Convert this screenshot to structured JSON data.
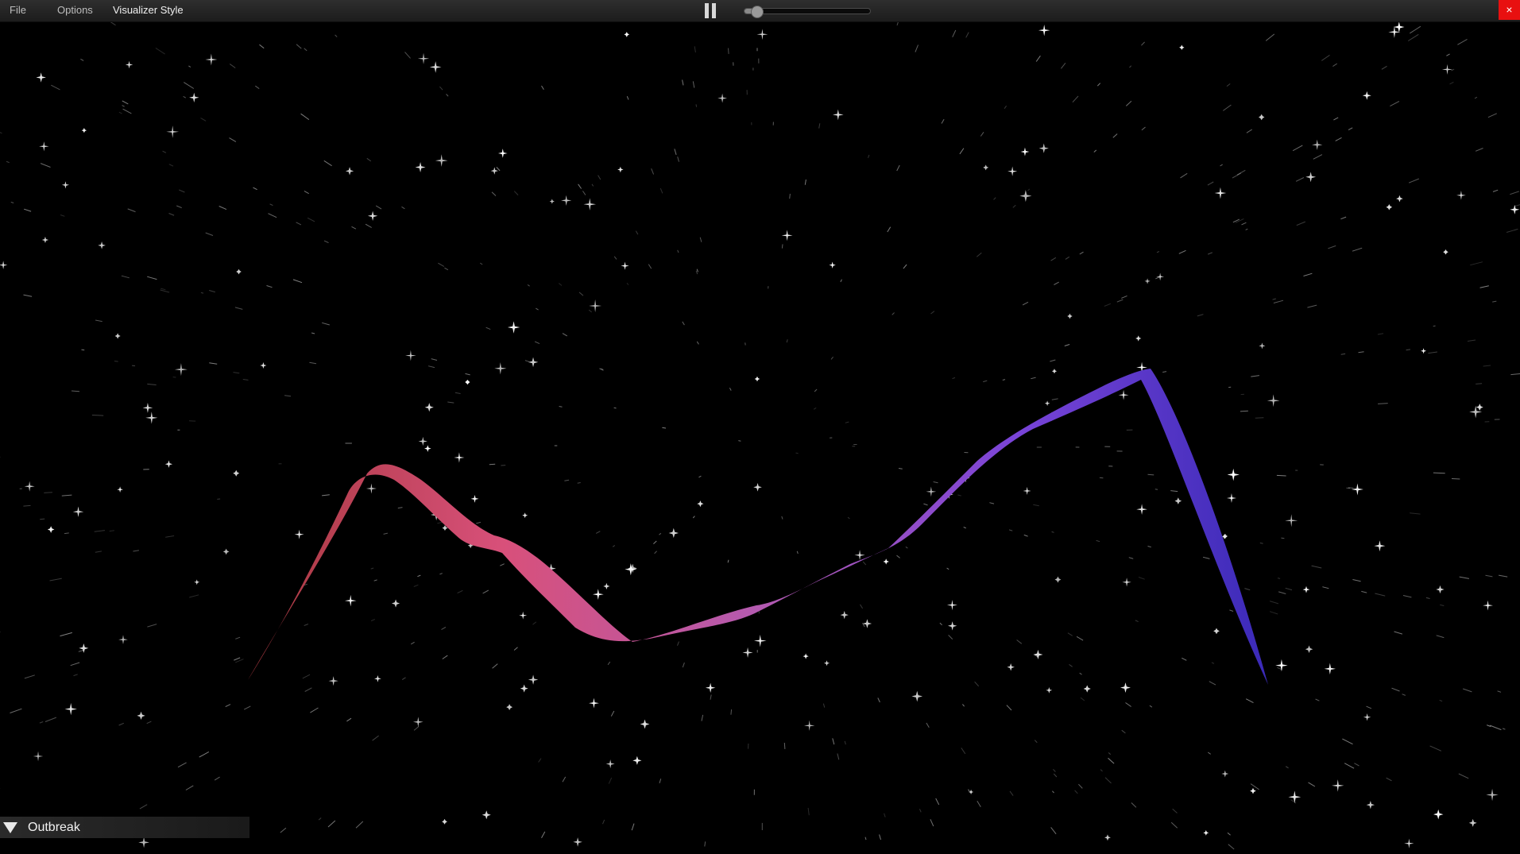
{
  "menu": {
    "file": "File",
    "options": "Options",
    "visualizer_style": "Visualizer Style"
  },
  "playback": {
    "state_icon": "pause-icon",
    "seek_fraction": 0.1
  },
  "window": {
    "close_label": "×",
    "close_color": "#e81010"
  },
  "visualizer": {
    "background": "#000000",
    "waveform_gradient": [
      "#a8383e",
      "#d8507a",
      "#b45ab0",
      "#7a44d8",
      "#3a2ab8"
    ],
    "star_color": "#ffffff"
  },
  "panel": {
    "toggle_icon": "triangle-down-icon",
    "label": "Outbreak"
  }
}
